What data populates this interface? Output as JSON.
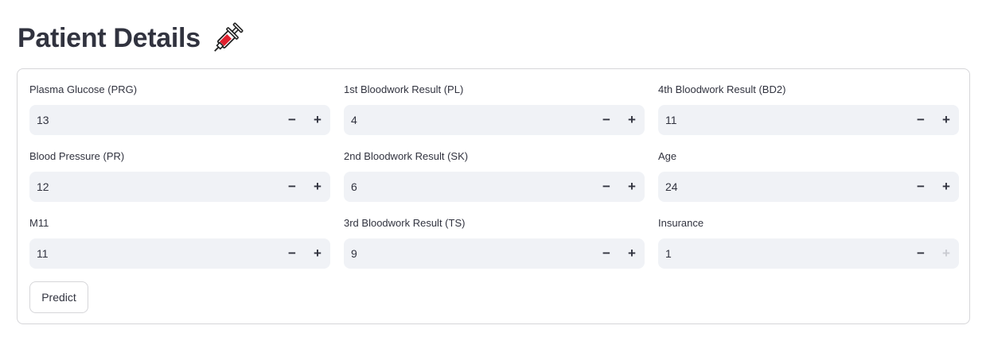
{
  "header": {
    "title": "Patient Details",
    "icon": "syringe-icon"
  },
  "form": {
    "fields": [
      {
        "label": "Plasma Glucose (PRG)",
        "value": "13",
        "plus_enabled": true
      },
      {
        "label": "1st Bloodwork Result (PL)",
        "value": "4",
        "plus_enabled": true
      },
      {
        "label": "4th Bloodwork Result (BD2)",
        "value": "11",
        "plus_enabled": true
      },
      {
        "label": "Blood Pressure (PR)",
        "value": "12",
        "plus_enabled": true
      },
      {
        "label": "2nd Bloodwork Result (SK)",
        "value": "6",
        "plus_enabled": true
      },
      {
        "label": "Age",
        "value": "24",
        "plus_enabled": true
      },
      {
        "label": "M11",
        "value": "11",
        "plus_enabled": true
      },
      {
        "label": "3rd Bloodwork Result (TS)",
        "value": "9",
        "plus_enabled": true
      },
      {
        "label": "Insurance",
        "value": "1",
        "plus_enabled": false
      }
    ],
    "minus_symbol": "−",
    "plus_symbol": "+",
    "submit_label": "Predict"
  },
  "colors": {
    "text": "#31333f",
    "input_bg": "#f0f2f6",
    "border": "#d6d6d9",
    "syringe_accent": "#e0202e"
  }
}
